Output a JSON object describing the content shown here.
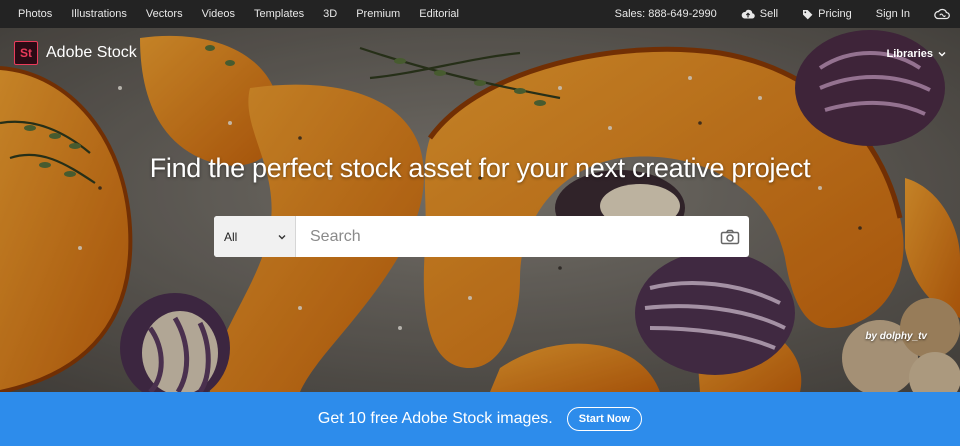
{
  "topnav": {
    "categories": [
      "Photos",
      "Illustrations",
      "Vectors",
      "Videos",
      "Templates",
      "3D",
      "Premium",
      "Editorial"
    ],
    "sales": "Sales: 888-649-2990",
    "sell": "Sell",
    "pricing": "Pricing",
    "signin": "Sign In",
    "icons": {
      "sell": "cloud-upload-icon",
      "pricing": "tag-icon",
      "account": "creative-cloud-icon"
    }
  },
  "brand": {
    "logo_text": "St",
    "name": "Adobe Stock",
    "accent": "#ea3b5a"
  },
  "libraries": {
    "label": "Libraries"
  },
  "hero": {
    "headline": "Find the perfect stock asset for your next creative project",
    "credit": "by dolphy_tv"
  },
  "search": {
    "category": "All",
    "placeholder": "Search",
    "icon": "camera-icon"
  },
  "promo": {
    "text": "Get 10 free Adobe Stock images.",
    "button": "Start Now",
    "color": "#2d8ceb"
  }
}
